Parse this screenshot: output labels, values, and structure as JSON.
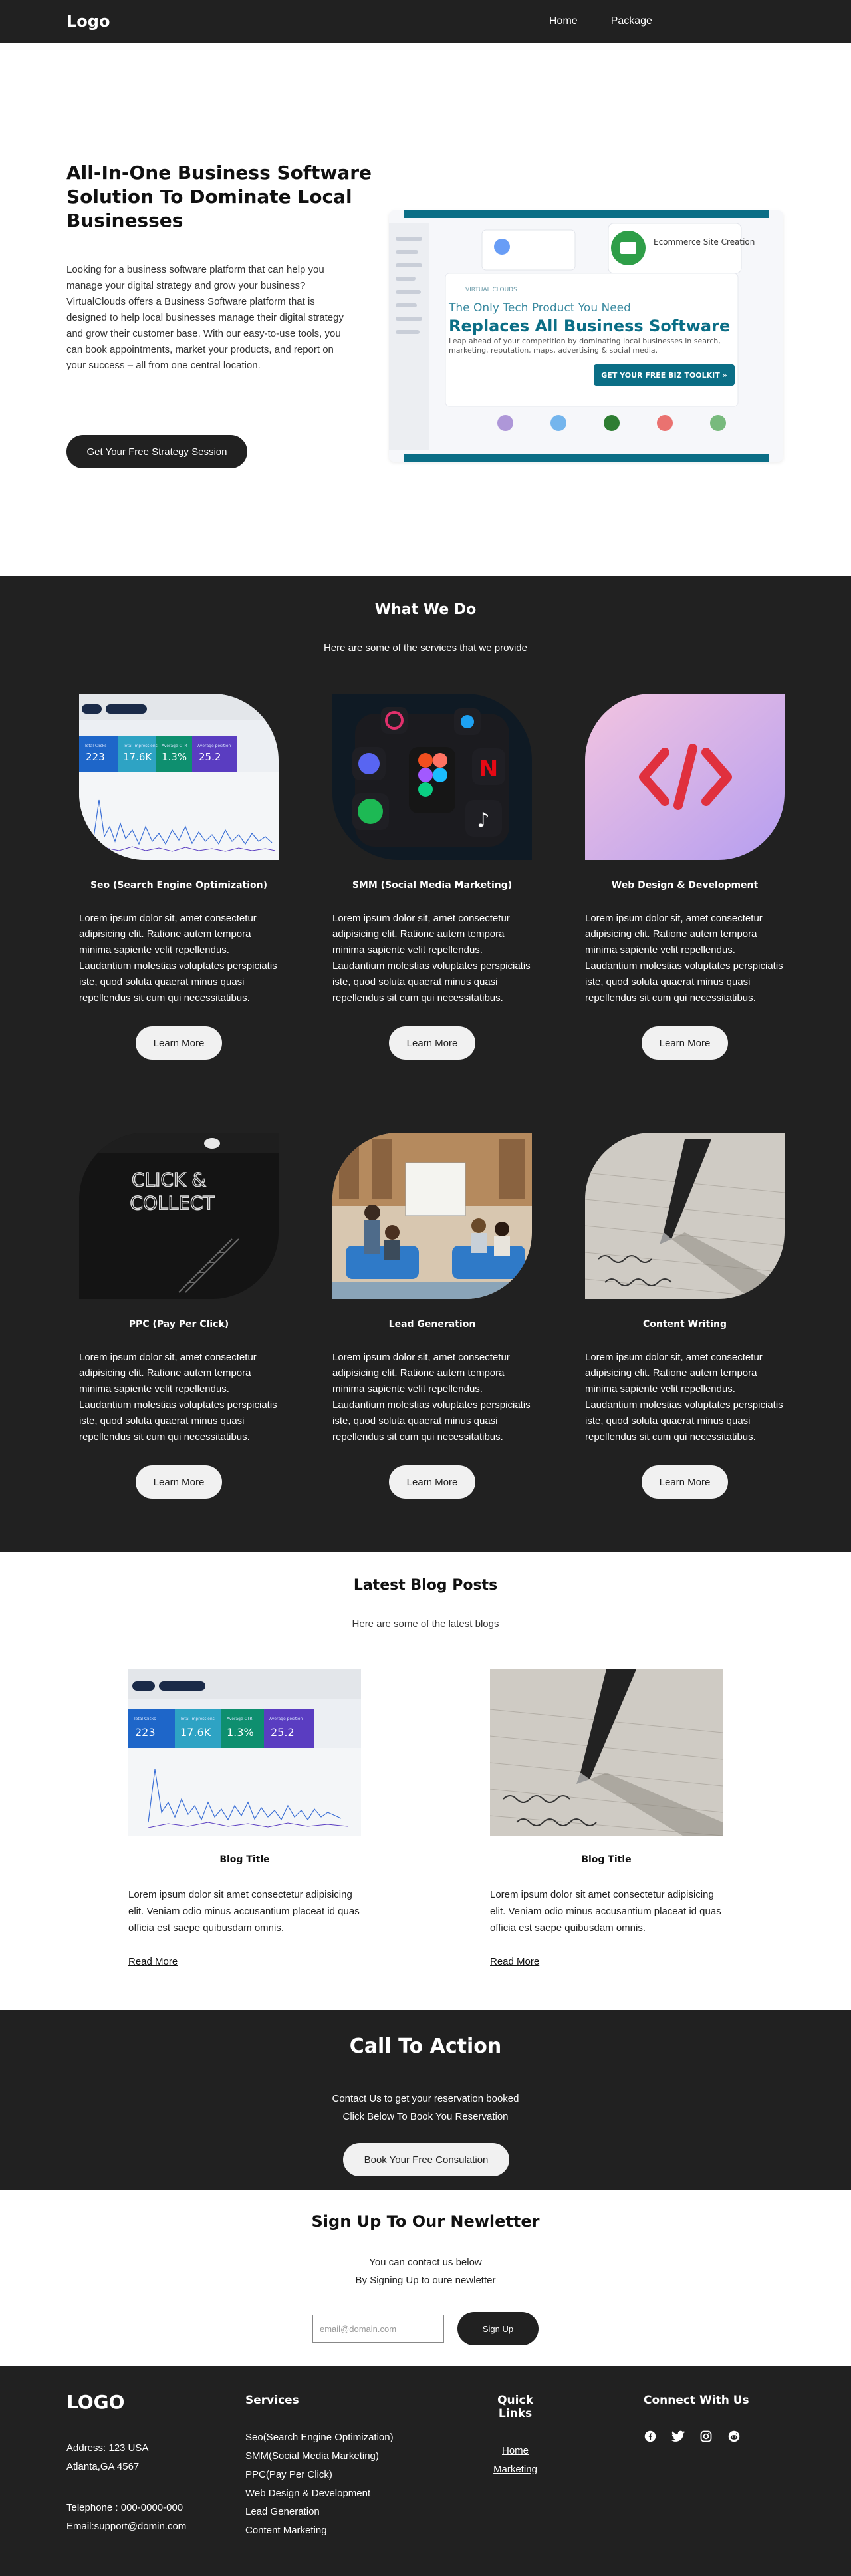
{
  "nav": {
    "logo": "Logo",
    "links": [
      "Home",
      "Package"
    ]
  },
  "hero": {
    "title": "All-In-One Business Software Solution To Dominate Local Businesses",
    "description": "Looking for a business software platform that can help you manage your digital strategy and grow your business? VirtualClouds offers a Business Software platform that is designed to help local businesses manage their digital strategy and grow their customer base. With our easy-to-use tools, you can book appointments, market your products, and report on your success – all from one central location.",
    "cta_label": "Get Your Free Strategy Session",
    "image": {
      "brand": "VIRTUAL CLOUDS",
      "tagline": "The Only Tech Product You Need",
      "headline": "Replaces All Business Software",
      "subtext": "Leap ahead of your competition by dominating local businesses in search, marketing, reputation, maps, advertising & social media.",
      "button": "GET YOUR FREE BIZ TOOLKIT »",
      "widget_label": "Ecommerce Site Creation"
    }
  },
  "services": {
    "title": "What We Do",
    "subtitle": "Here are some of the services that we provide",
    "learn_more_label": "Learn More",
    "stat_tiles": [
      {
        "label": "Total Clicks",
        "value": "223"
      },
      {
        "label": "Total impressions",
        "value": "17.6K"
      },
      {
        "label": "Average CTR",
        "value": "1.3%"
      },
      {
        "label": "Average position",
        "value": "25.2"
      }
    ],
    "neon_sign": [
      "CLICK &",
      "COLLECT"
    ],
    "items": [
      {
        "title": "Seo (Search Engine Optimization)",
        "description": "Lorem ipsum dolor sit, amet consectetur adipisicing elit. Ratione autem tempora minima sapiente velit repellendus. Laudantium molestias voluptates perspiciatis iste, quod soluta quaerat minus quasi repellendus sit cum qui necessitatibus."
      },
      {
        "title": "SMM (Social Media Marketing)",
        "description": "Lorem ipsum dolor sit, amet consectetur adipisicing elit. Ratione autem tempora minima sapiente velit repellendus. Laudantium molestias voluptates perspiciatis iste, quod soluta quaerat minus quasi repellendus sit cum qui necessitatibus."
      },
      {
        "title": "Web Design & Development",
        "description": "Lorem ipsum dolor sit, amet consectetur adipisicing elit. Ratione autem tempora minima sapiente velit repellendus. Laudantium molestias voluptates perspiciatis iste, quod soluta quaerat minus quasi repellendus sit cum qui necessitatibus."
      },
      {
        "title": "PPC (Pay Per Click)",
        "description": "Lorem ipsum dolor sit, amet consectetur adipisicing elit. Ratione autem tempora minima sapiente velit repellendus. Laudantium molestias voluptates perspiciatis iste, quod soluta quaerat minus quasi repellendus sit cum qui necessitatibus."
      },
      {
        "title": "Lead Generation",
        "description": "Lorem ipsum dolor sit, amet consectetur adipisicing elit. Ratione autem tempora minima sapiente velit repellendus. Laudantium molestias voluptates perspiciatis iste, quod soluta quaerat minus quasi repellendus sit cum qui necessitatibus."
      },
      {
        "title": "Content Writing",
        "description": "Lorem ipsum dolor sit, amet consectetur adipisicing elit. Ratione autem tempora minima sapiente velit repellendus. Laudantium molestias voluptates perspiciatis iste, quod soluta quaerat minus quasi repellendus sit cum qui necessitatibus."
      }
    ]
  },
  "blog": {
    "title": "Latest Blog Posts",
    "subtitle": "Here are some of the latest blogs",
    "posts": [
      {
        "title": "Blog Title",
        "excerpt": "Lorem ipsum dolor sit amet consectetur adipisicing elit. Veniam odio minus accusantium placeat id quas officia est saepe quibusdam omnis.",
        "link_label": "Read More"
      },
      {
        "title": "Blog Title",
        "excerpt": "Lorem ipsum dolor sit amet consectetur adipisicing elit. Veniam odio minus accusantium placeat id quas officia est saepe quibusdam omnis.",
        "link_label": "Read More"
      }
    ]
  },
  "cta": {
    "title": "Call To Action",
    "line1": "Contact Us to get your reservation booked",
    "line2": "Click Below To Book You Reservation",
    "button_label": "Book Your Free Consulation"
  },
  "newsletter": {
    "title": "Sign Up To Our Newletter",
    "line1": "You can contact us below",
    "line2": "By Signing Up to oure newletter",
    "email_placeholder": "email@domain.com",
    "button_label": "Sign Up"
  },
  "footer": {
    "logo": "LOGO",
    "address_line1": "Address: 123 USA",
    "address_line2": "Atlanta,GA 4567",
    "phone": "Telephone : 000-0000-000",
    "email": "Email:support@domin.com",
    "services_title": "Services",
    "services": [
      "Seo(Search Engine Optimization)",
      "SMM(Social Media Marketing)",
      "PPC(Pay Per Click)",
      "Web Design & Development",
      "Lead Generation",
      "Content Marketing"
    ],
    "quick_links_title": "Quick Links",
    "quick_links": [
      "Home",
      "Marketing"
    ],
    "connect_title": "Connect With Us",
    "social_icons": [
      "facebook-icon",
      "twitter-icon",
      "instagram-icon",
      "reddit-icon"
    ]
  },
  "colors": {
    "dark": "#212121",
    "light_button": "#f1f1f1",
    "accent_teal": "#0b6e86",
    "accent_green": "#2e9e48"
  }
}
